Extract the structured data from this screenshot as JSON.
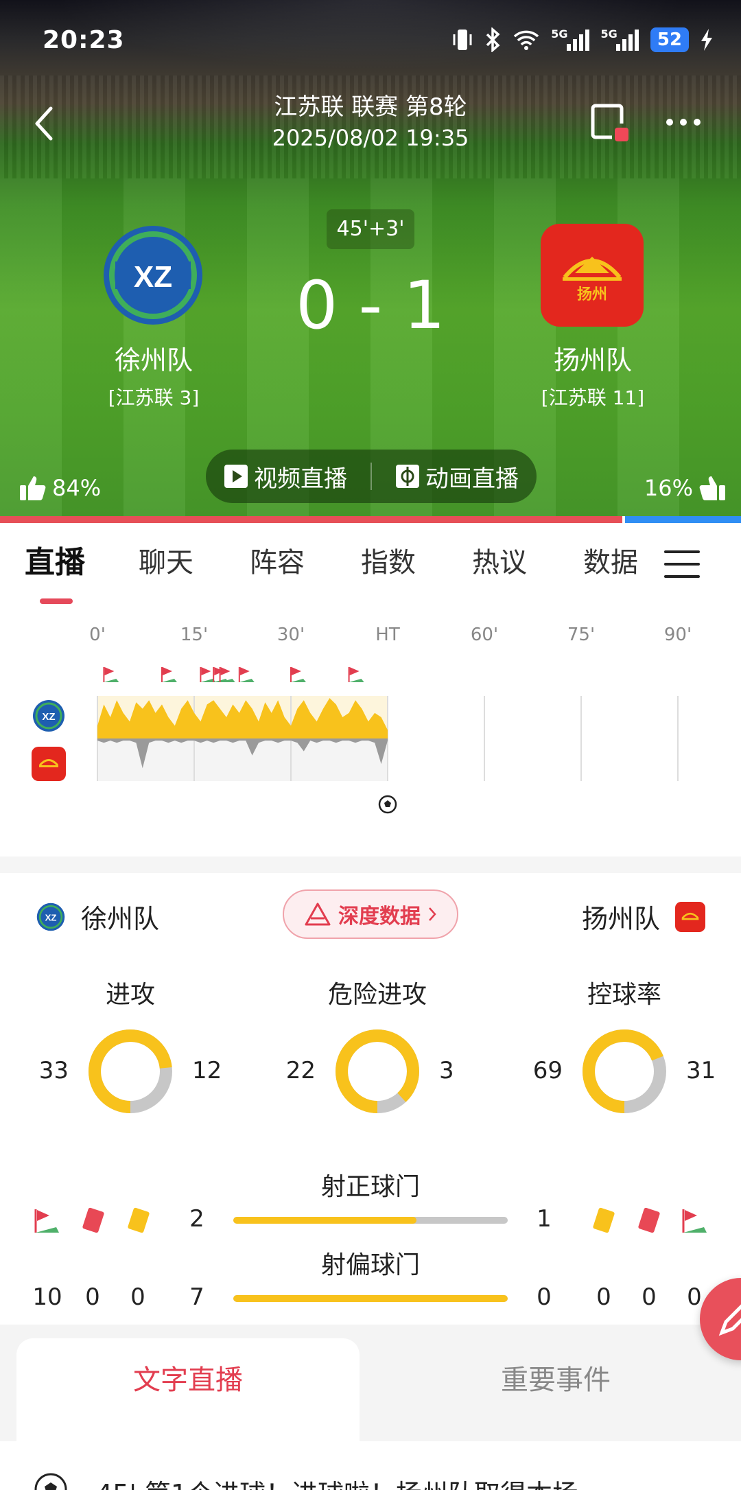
{
  "status": {
    "time": "20:23",
    "network_1": "5G",
    "network_2": "5G",
    "battery": "52",
    "icons": [
      "vibrate-icon",
      "bluetooth-icon",
      "wifi-icon",
      "signal-icon",
      "signal-icon",
      "battery-icon",
      "charging-icon"
    ]
  },
  "header": {
    "title": "江苏联 联赛 第8轮",
    "datetime": "2025/08/02 19:35",
    "icons": [
      "back-icon",
      "cast-icon",
      "more-icon"
    ]
  },
  "match": {
    "time": "45'+3'",
    "score": "0 - 1",
    "home": {
      "name": "徐州队",
      "rank": "[江苏联 3]",
      "logo_text": "XZ",
      "color": "#1e5eb0"
    },
    "away": {
      "name": "扬州队",
      "rank": "[江苏联 11]",
      "logo_text": "扬州",
      "color": "#e3271e"
    },
    "video_live": "视频直播",
    "animation_live": "动画直播",
    "vote_home": "84%",
    "vote_away": "16%",
    "vote_home_value": 84,
    "vote_away_value": 16
  },
  "tabs": [
    "直播",
    "聊天",
    "阵容",
    "指数",
    "热议",
    "数据"
  ],
  "active_tab": "直播",
  "timeline": {
    "labels": [
      "0'",
      "15'",
      "30'",
      "HT",
      "60'",
      "75'",
      "90'"
    ],
    "corner_flags_minutes": [
      1,
      10,
      16,
      18,
      19,
      22,
      30,
      39
    ],
    "goal_minute": 45,
    "home_pressure": [
      0.3,
      0.8,
      0.5,
      0.9,
      0.6,
      0.4,
      0.85,
      0.7,
      0.9,
      0.6,
      0.8,
      0.5,
      0.3,
      0.7,
      0.9,
      0.6,
      0.4,
      0.8,
      0.9,
      0.7,
      0.5,
      0.8,
      0.6,
      0.9,
      0.7,
      0.4,
      0.85,
      0.6,
      0.9,
      0.5,
      0.3,
      0.7,
      0.9,
      0.6,
      0.4,
      0.7,
      0.95,
      0.8,
      0.5,
      0.6,
      0.9,
      0.7,
      0.4,
      0.6,
      0.5,
      0.2
    ],
    "away_pressure": [
      0.05,
      0.1,
      0.05,
      0.1,
      0.05,
      0.05,
      0.1,
      0.7,
      0.1,
      0.05,
      0.05,
      0.1,
      0.05,
      0.1,
      0.05,
      0.05,
      0.1,
      0.05,
      0.1,
      0.05,
      0.05,
      0.1,
      0.05,
      0.05,
      0.4,
      0.1,
      0.05,
      0.05,
      0.1,
      0.05,
      0.05,
      0.1,
      0.3,
      0.05,
      0.1,
      0.05,
      0.05,
      0.1,
      0.05,
      0.05,
      0.1,
      0.05,
      0.05,
      0.1,
      0.6,
      0.05
    ]
  },
  "stats": {
    "home_name": "徐州队",
    "away_name": "扬州队",
    "deep_data": "深度数据",
    "donuts": [
      {
        "title": "进攻",
        "home": "33",
        "away": "12",
        "home_value": 33,
        "away_value": 12
      },
      {
        "title": "危险进攻",
        "home": "22",
        "away": "3",
        "home_value": 22,
        "away_value": 3
      },
      {
        "title": "控球率",
        "home": "69",
        "away": "31",
        "home_value": 69,
        "away_value": 31
      }
    ],
    "on_target": {
      "title": "射正球门",
      "home": "2",
      "away": "1",
      "home_value": 2,
      "away_value": 1
    },
    "off_target": {
      "title": "射偏球门",
      "home": "7",
      "away": "0",
      "home_value": 7,
      "away_value": 0
    },
    "home_corners": "10",
    "home_red": "0",
    "home_yellow": "0",
    "away_yellow": "0",
    "away_red": "0",
    "away_corners": "0",
    "colors": {
      "home": "#f8c21c",
      "away": "#c7c7c7"
    }
  },
  "bottom_tabs": [
    "文字直播",
    "重要事件"
  ],
  "feed_first": "45' 第1个进球！进球啦！扬州队取得本场"
}
